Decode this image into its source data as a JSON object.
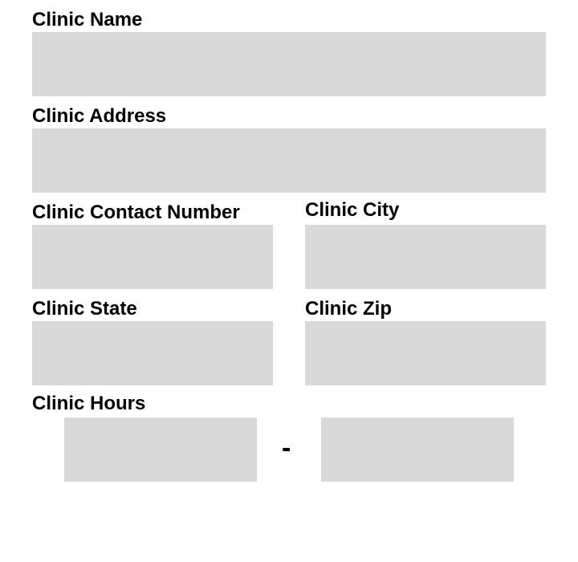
{
  "form": {
    "clinic_name": {
      "label": "Clinic Name",
      "value": ""
    },
    "clinic_address": {
      "label": "Clinic Address",
      "value": ""
    },
    "clinic_contact_number": {
      "label": "Clinic Contact Number",
      "value": ""
    },
    "clinic_city": {
      "label": "Clinic City",
      "value": ""
    },
    "clinic_state": {
      "label": "Clinic State",
      "value": ""
    },
    "clinic_zip": {
      "label": "Clinic Zip",
      "value": ""
    },
    "clinic_hours": {
      "label": "Clinic Hours",
      "open_value": "",
      "separator": "-",
      "close_value": ""
    }
  },
  "colors": {
    "field_background": "#d9d9d9",
    "text": "#000000",
    "page_background": "#ffffff"
  }
}
